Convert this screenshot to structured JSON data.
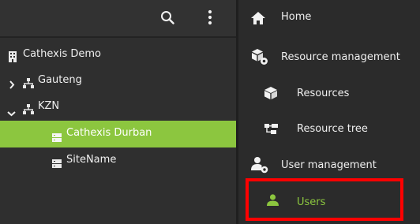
{
  "colors": {
    "accent_green": "#8cc63f",
    "highlight_red": "#ff0000"
  },
  "toolbar": {
    "search_icon": "search-icon",
    "more_icon": "more-vertical-icon"
  },
  "tree": {
    "root": {
      "label": "Cathexis Demo",
      "icon": "building-icon"
    },
    "nodes": [
      {
        "label": "Gauteng",
        "icon": "hierarchy-icon",
        "expander": "chevron-right-icon"
      },
      {
        "label": "KZN",
        "icon": "hierarchy-icon",
        "expander": "chevron-down-icon"
      },
      {
        "label": "Cathexis Durban",
        "icon": "server-icon",
        "selected": true
      },
      {
        "label": "SiteName",
        "icon": "server-icon"
      }
    ]
  },
  "nav": {
    "home": {
      "label": "Home",
      "icon": "home-icon"
    },
    "resource_management": {
      "label": "Resource management",
      "icon": "cube-gear-icon"
    },
    "resources": {
      "label": "Resources",
      "icon": "cube-icon"
    },
    "resource_tree": {
      "label": "Resource tree",
      "icon": "resource-tree-icon"
    },
    "user_management": {
      "label": "User management",
      "icon": "user-gear-icon"
    },
    "users": {
      "label": "Users",
      "icon": "user-icon",
      "active": true
    }
  }
}
